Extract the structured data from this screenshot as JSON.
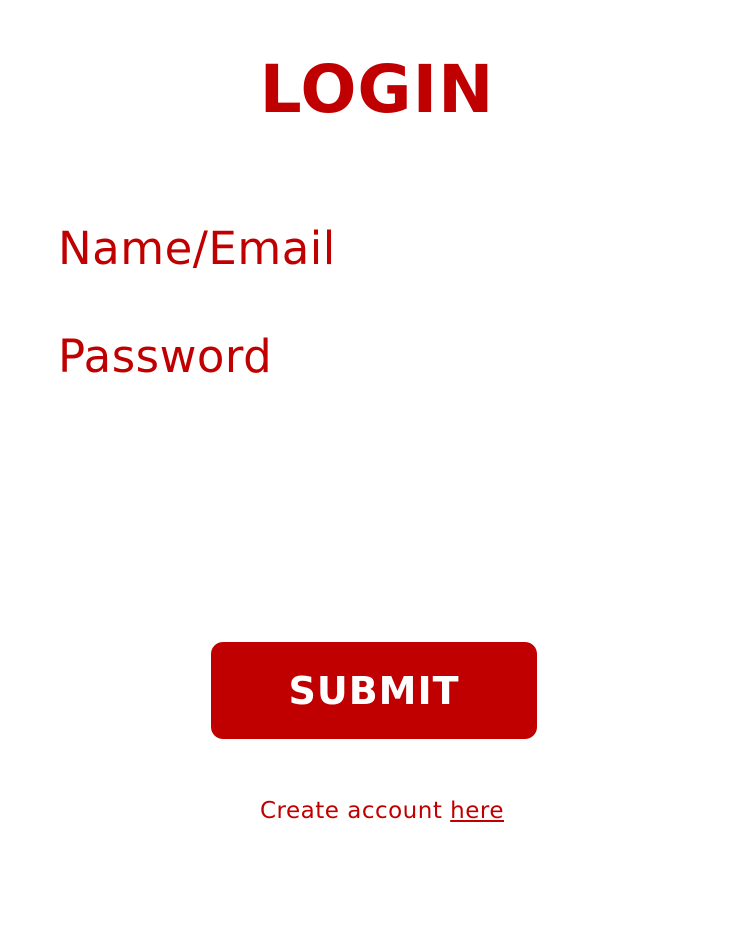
{
  "page": {
    "title": "LOGIN"
  },
  "form": {
    "name_label": "Name/Email",
    "password_label": "Password",
    "submit_label": "SUBMIT"
  },
  "footer": {
    "prefix": "Create account ",
    "link_label": "here"
  },
  "colors": {
    "accent": "#c00000",
    "background": "#ffffff",
    "button_text": "#ffffff"
  }
}
